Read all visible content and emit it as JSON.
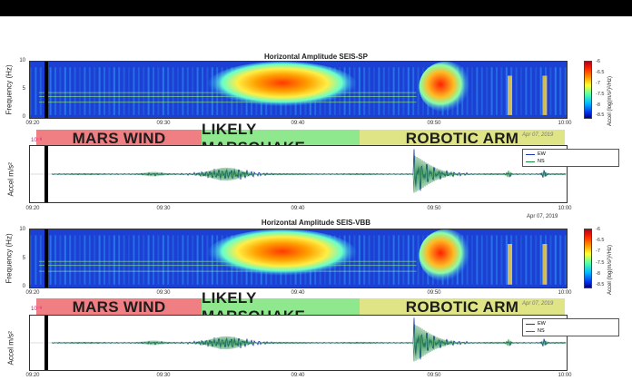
{
  "chart_data": [
    {
      "type": "heatmap",
      "title": "Horizontal Amplitude SEIS-SP",
      "ylabel": "Frequency (Hz)",
      "y_ticks": [
        "0",
        "5",
        "10"
      ],
      "ylim": [
        0,
        10
      ],
      "x_ticks": [
        "09:20",
        "09:30",
        "09:40",
        "09:50",
        "10:00"
      ],
      "colorbar_label": "Accel (log(m/s²)²/Hz)",
      "colorbar_ticks": [
        "-6",
        "-6.5",
        "-7",
        "-7.5",
        "-8",
        "-8.5"
      ]
    },
    {
      "type": "line",
      "ylabel": "Accel m/s²",
      "y_tag": "10⁻⁸",
      "x_ticks": [
        "09:20",
        "09:30",
        "09:40",
        "09:50",
        "10:00"
      ],
      "legend": [
        "EW",
        "NS"
      ],
      "series_colors": [
        "#1b35b5",
        "#1e8a3e"
      ],
      "date_label": "Apr 07, 2019",
      "watermark": "Apr 07, 2019"
    },
    {
      "type": "heatmap",
      "title": "Horizontal Amplitude SEIS-VBB",
      "ylabel": "Frequency (Hz)",
      "y_ticks": [
        "0",
        "5",
        "10"
      ],
      "ylim": [
        0,
        10
      ],
      "x_ticks": [
        "09:20",
        "09:30",
        "09:40",
        "09:50",
        "10:00"
      ],
      "colorbar_label": "Accel (log(m/s²)²/Hz)",
      "colorbar_ticks": [
        "-6",
        "-6.5",
        "-7",
        "-7.5",
        "-8",
        "-8.5"
      ]
    },
    {
      "type": "line",
      "ylabel": "Accel m/s²",
      "y_tag": "10⁻⁸",
      "x_ticks": [
        "09:20",
        "09:30",
        "09:40",
        "09:50",
        "10:00"
      ],
      "legend": [
        "EW",
        "NS"
      ],
      "series_colors": [
        "#1b35b5",
        "#1e8a3e"
      ],
      "watermark": "Apr 07, 2019"
    }
  ],
  "segments": [
    {
      "label": "MARS WIND",
      "color": "#f07f84"
    },
    {
      "label": "LIKELY MARSQUAKE",
      "color": "#8fe88e"
    },
    {
      "label": "ROBOTIC ARM",
      "color": "#dfe487"
    }
  ],
  "colors": {
    "spectro_bg": "#1c3fd4",
    "wave_ew": "#1b35b5",
    "wave_ns": "#1e8a3e"
  }
}
